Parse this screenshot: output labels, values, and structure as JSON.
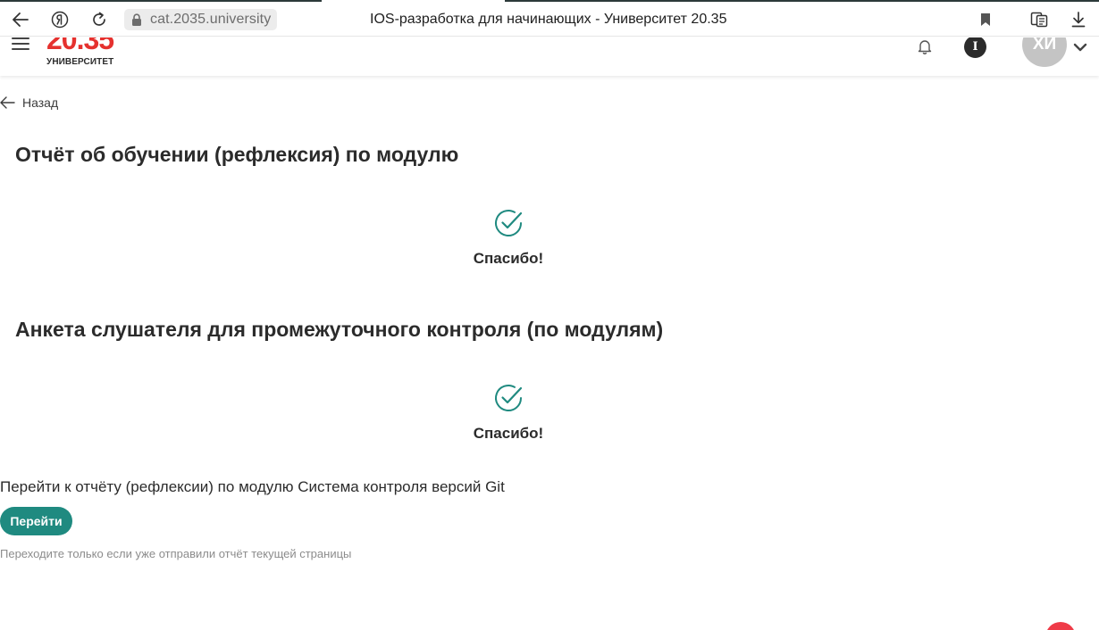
{
  "browser": {
    "url": "cat.2035.university",
    "page_title": "IOS-разработка для начинающих - Университет 20.35",
    "icons": [
      "back-arrow-icon",
      "yandex-icon",
      "reload-icon",
      "lock-icon",
      "bookmark-icon",
      "reader-mode-icon",
      "download-icon"
    ]
  },
  "header": {
    "logo_number": "20.35",
    "logo_caption": "УНИВЕРСИТЕТ",
    "info_letter": "I",
    "avatar_initials": "ХИ"
  },
  "nav": {
    "back_label": "Назад"
  },
  "sections": [
    {
      "title": "Отчёт об обучении (рефлексия) по модулю",
      "status": "Спасибо!"
    },
    {
      "title": "Анкета слушателя для промежуточного контроля (по модулям)",
      "status": "Спасибо!"
    }
  ],
  "next_step": {
    "text": "Перейти к отчёту (рефлексии) по модулю Система контроля версий Git",
    "button_label": "Перейти",
    "hint": "Переходите только если уже отправили отчёт текущей страницы"
  },
  "colors": {
    "accent": "#1f8a80",
    "logo_red": "#e5312e",
    "fab_red": "#ef3b48"
  }
}
